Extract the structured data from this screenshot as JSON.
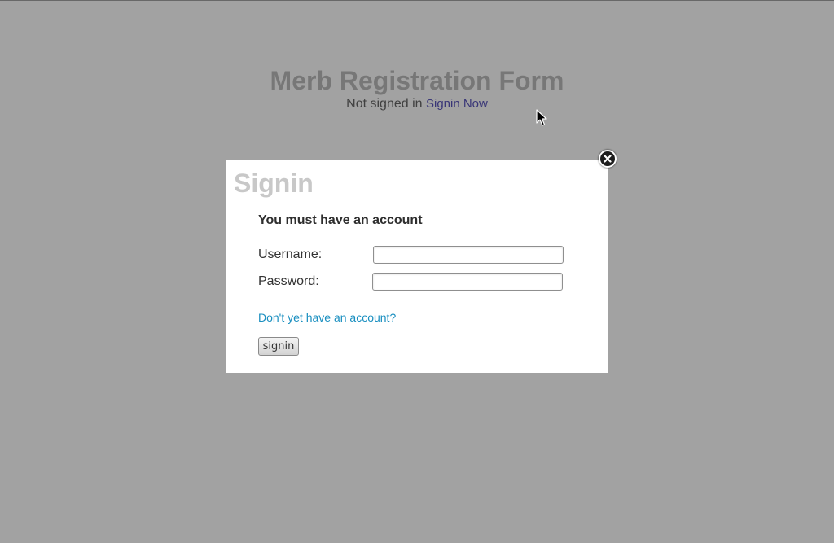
{
  "page": {
    "title": "Merb Registration Form",
    "status_prefix": "Not signed in",
    "signin_link": "Signin Now"
  },
  "modal": {
    "title": "Signin",
    "notice": "You must have an account",
    "username_label": "Username:",
    "username_value": "",
    "password_label": "Password:",
    "password_value": "",
    "register_link": "Don't yet have an account?",
    "submit_label": "signin",
    "close_icon": "close-icon"
  },
  "colors": {
    "overlay": "#a0a0a0",
    "link": "#1a8fc0",
    "title": "#a8a8a8"
  }
}
